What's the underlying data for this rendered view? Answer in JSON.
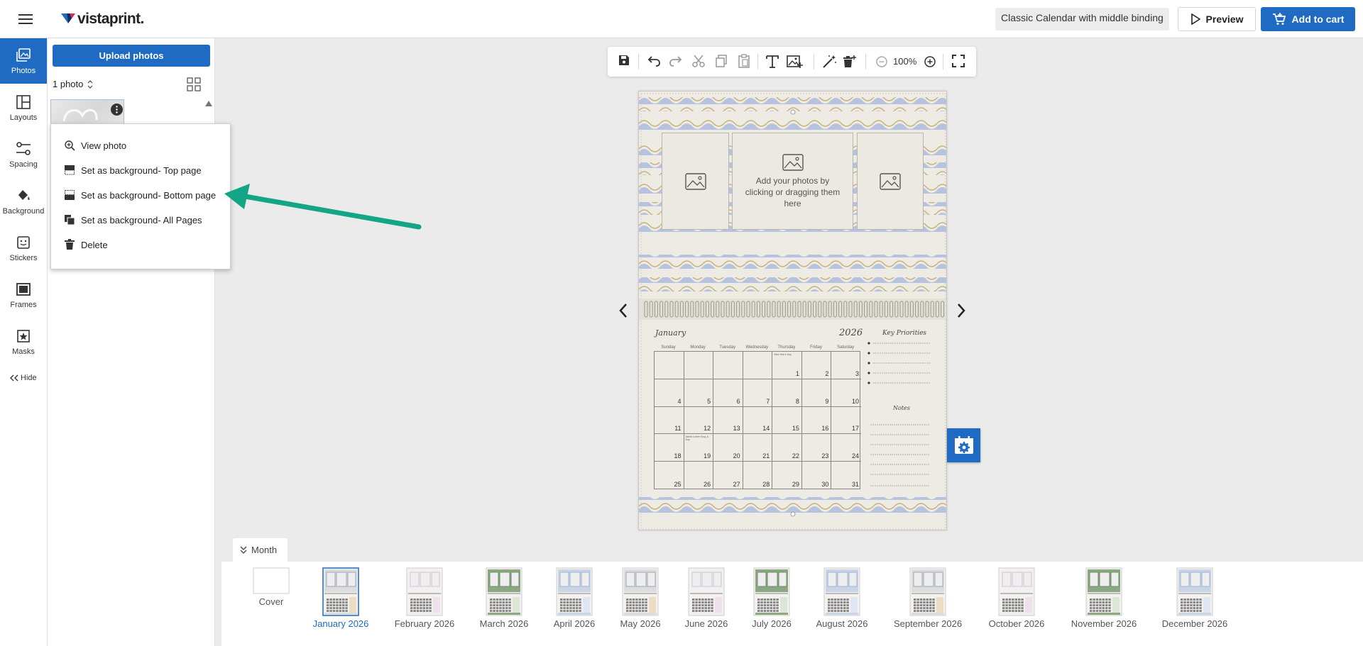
{
  "header": {
    "logo_text": "vistaprint.",
    "calendar_name": "Classic Calendar with middle binding",
    "preview_label": "Preview",
    "cart_label": "Add to cart"
  },
  "rail": {
    "items": [
      {
        "label": "Photos",
        "icon": "photos-icon",
        "active": true
      },
      {
        "label": "Layouts",
        "icon": "layouts-icon"
      },
      {
        "label": "Spacing",
        "icon": "spacing-icon"
      },
      {
        "label": "Background",
        "icon": "paint-bucket-icon"
      },
      {
        "label": "Stickers",
        "icon": "sticker-icon"
      },
      {
        "label": "Frames",
        "icon": "frame-icon"
      },
      {
        "label": "Masks",
        "icon": "mask-icon"
      }
    ],
    "hide_label": "Hide"
  },
  "panel": {
    "upload_label": "Upload photos",
    "photo_count": "1 photo"
  },
  "context_menu": {
    "items": [
      {
        "label": "View photo",
        "icon": "zoom-in-icon"
      },
      {
        "label": "Set as background- Top page",
        "icon": "bg-top-icon"
      },
      {
        "label": "Set as background- Bottom page",
        "icon": "bg-bottom-icon"
      },
      {
        "label": "Set as background- All Pages",
        "icon": "bg-all-icon"
      },
      {
        "label": "Delete",
        "icon": "trash-icon"
      }
    ]
  },
  "toolbar": {
    "zoom": "100%"
  },
  "canvas": {
    "photo_hint": "Add your photos by clicking or dragging them here",
    "month": "January",
    "year": "2026",
    "key_priorities": "Key Priorities",
    "notes": "Notes",
    "weekdays": [
      "Sunday",
      "Monday",
      "Tuesday",
      "Wednesday",
      "Thursday",
      "Friday",
      "Saturday"
    ],
    "weeks": [
      [
        "",
        "",
        "",
        "",
        "1",
        "2",
        "3"
      ],
      [
        "4",
        "5",
        "6",
        "7",
        "8",
        "9",
        "10"
      ],
      [
        "11",
        "12",
        "13",
        "14",
        "15",
        "16",
        "17"
      ],
      [
        "18",
        "19",
        "20",
        "21",
        "22",
        "23",
        "24"
      ],
      [
        "25",
        "26",
        "27",
        "28",
        "29",
        "30",
        "31"
      ]
    ],
    "holiday_1": "New Year's Day",
    "holiday_2": "Martin Luther King Jr. Day"
  },
  "month_strip": {
    "toggle_label": "Month",
    "pages": [
      {
        "label": "Cover",
        "style": "blank"
      },
      {
        "label": "January 2026",
        "style": "gray",
        "selected": true
      },
      {
        "label": "February 2026",
        "style": "pink"
      },
      {
        "label": "March 2026",
        "style": "green"
      },
      {
        "label": "April 2026",
        "style": "blue"
      },
      {
        "label": "May 2026",
        "style": "gray"
      },
      {
        "label": "June 2026",
        "style": "pink"
      },
      {
        "label": "July 2026",
        "style": "green"
      },
      {
        "label": "August 2026",
        "style": "blue"
      },
      {
        "label": "September 2026",
        "style": "gray"
      },
      {
        "label": "October 2026",
        "style": "pink"
      },
      {
        "label": "November 2026",
        "style": "green"
      },
      {
        "label": "December 2026",
        "style": "blue"
      }
    ]
  },
  "colors": {
    "brand_blue": "#1f6ac2",
    "annotation_green": "#14a587",
    "wave_blue": "#b6c3de",
    "wave_gold": "#c8b27a"
  }
}
